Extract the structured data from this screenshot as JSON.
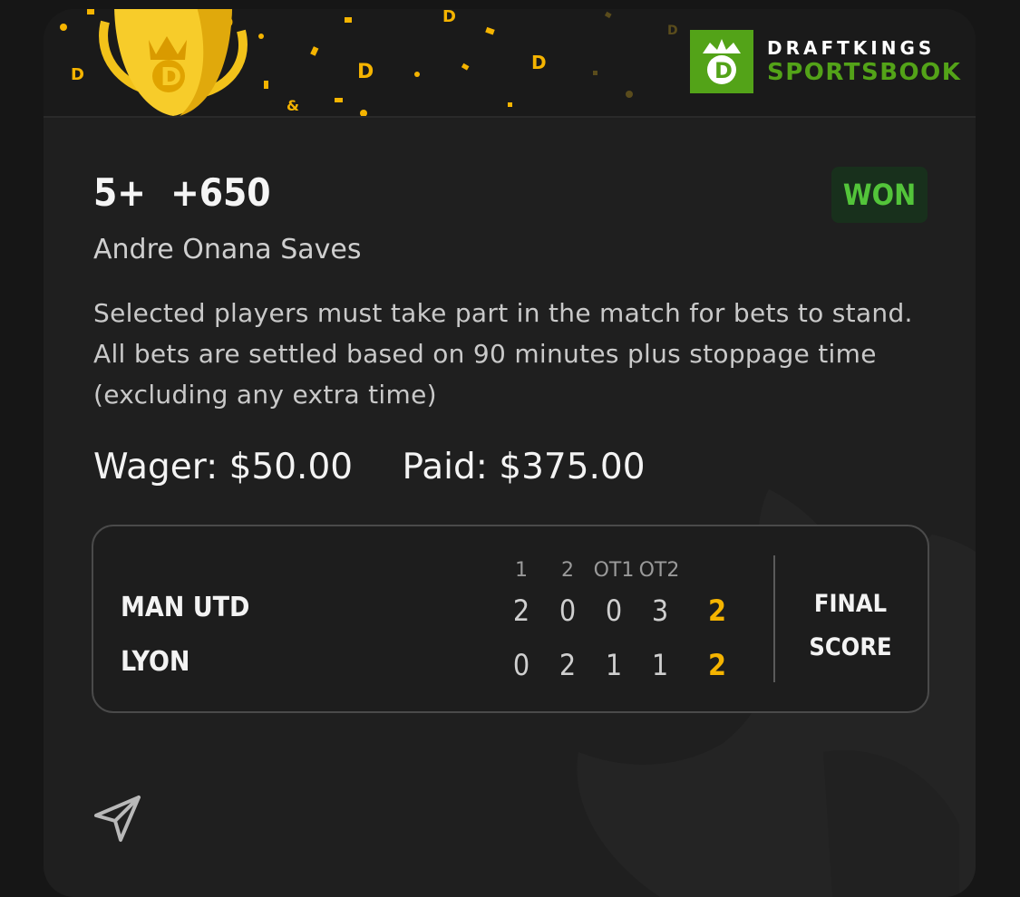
{
  "brand": {
    "line1": "DRAFTKINGS",
    "line2": "SPORTSBOOK",
    "green": "#53a318"
  },
  "bet": {
    "selection": "5+",
    "odds": "+650",
    "status": "WON",
    "market": "Andre Onana Saves",
    "rules": "Selected players must take part in the match for bets to stand. All bets are settled based on 90 minutes plus stoppage time (excluding any extra time)",
    "wager": "Wager: $50.00",
    "paid": "Paid: $375.00"
  },
  "scoreboard": {
    "periods": [
      "1",
      "2",
      "OT1",
      "OT2"
    ],
    "teams": [
      {
        "name": "MAN UTD",
        "scores": [
          "2",
          "0",
          "0",
          "3"
        ],
        "final": "2"
      },
      {
        "name": "LYON",
        "scores": [
          "0",
          "2",
          "1",
          "1"
        ],
        "final": "2"
      }
    ],
    "final_label_1": "FINAL",
    "final_label_2": "SCORE"
  },
  "icons": {
    "share": "send-icon",
    "trophy": "trophy-icon",
    "logo": "draftkings-logo-icon"
  },
  "colors": {
    "won": "#53c43a",
    "final_score": "#f5b400"
  }
}
